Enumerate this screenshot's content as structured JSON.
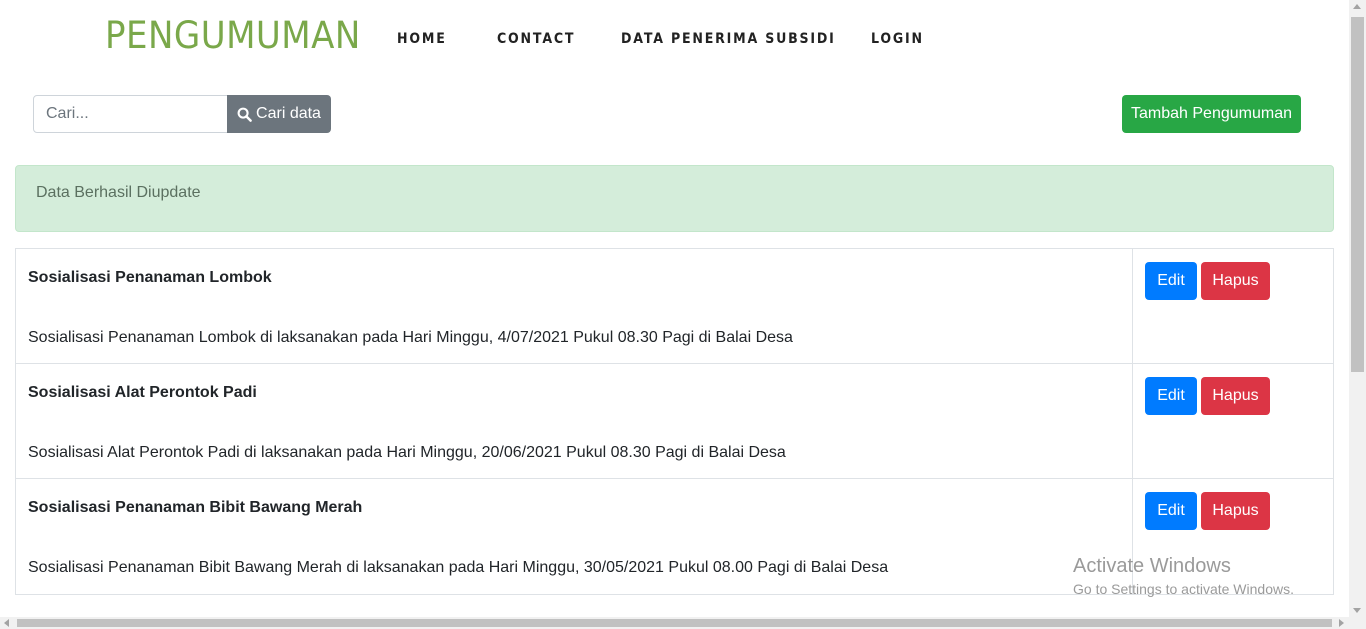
{
  "navbar": {
    "brand": "PENGUMUMAN",
    "links": [
      {
        "label": "HOME"
      },
      {
        "label": "CONTACT"
      },
      {
        "label": "DATA PENERIMA SUBSIDI"
      },
      {
        "label": "LOGIN"
      }
    ]
  },
  "search": {
    "placeholder": "Cari...",
    "value": "",
    "button_label": "Cari data"
  },
  "toolbar": {
    "add_label": "Tambah Pengumuman"
  },
  "alert": {
    "message": "Data Berhasil Diupdate"
  },
  "announcements": [
    {
      "title": "Sosialisasi Penanaman Lombok",
      "description": "Sosialisasi Penanaman Lombok di laksanakan pada Hari Minggu, 4/07/2021 Pukul 08.30 Pagi di Balai Desa",
      "edit_label": "Edit",
      "delete_label": "Hapus"
    },
    {
      "title": "Sosialisasi Alat Perontok Padi",
      "description": "Sosialisasi Alat Perontok Padi di laksanakan pada Hari Minggu, 20/06/2021 Pukul 08.30 Pagi di Balai Desa",
      "edit_label": "Edit",
      "delete_label": "Hapus"
    },
    {
      "title": "Sosialisasi Penanaman Bibit Bawang Merah",
      "description": "Sosialisasi Penanaman Bibit Bawang Merah di laksanakan pada Hari Minggu, 30/05/2021 Pukul 08.00 Pagi di Balai Desa",
      "edit_label": "Edit",
      "delete_label": "Hapus"
    }
  ],
  "watermark": {
    "title": "Activate Windows",
    "subtitle": "Go to Settings to activate Windows."
  },
  "colors": {
    "brand": "#7aa84a",
    "search_button": "#6c757d",
    "add_button": "#28a745",
    "alert_background": "#d4edda",
    "edit_button": "#007bff",
    "delete_button": "#dc3545"
  },
  "icons": {
    "search_button_icon": "search-icon"
  }
}
